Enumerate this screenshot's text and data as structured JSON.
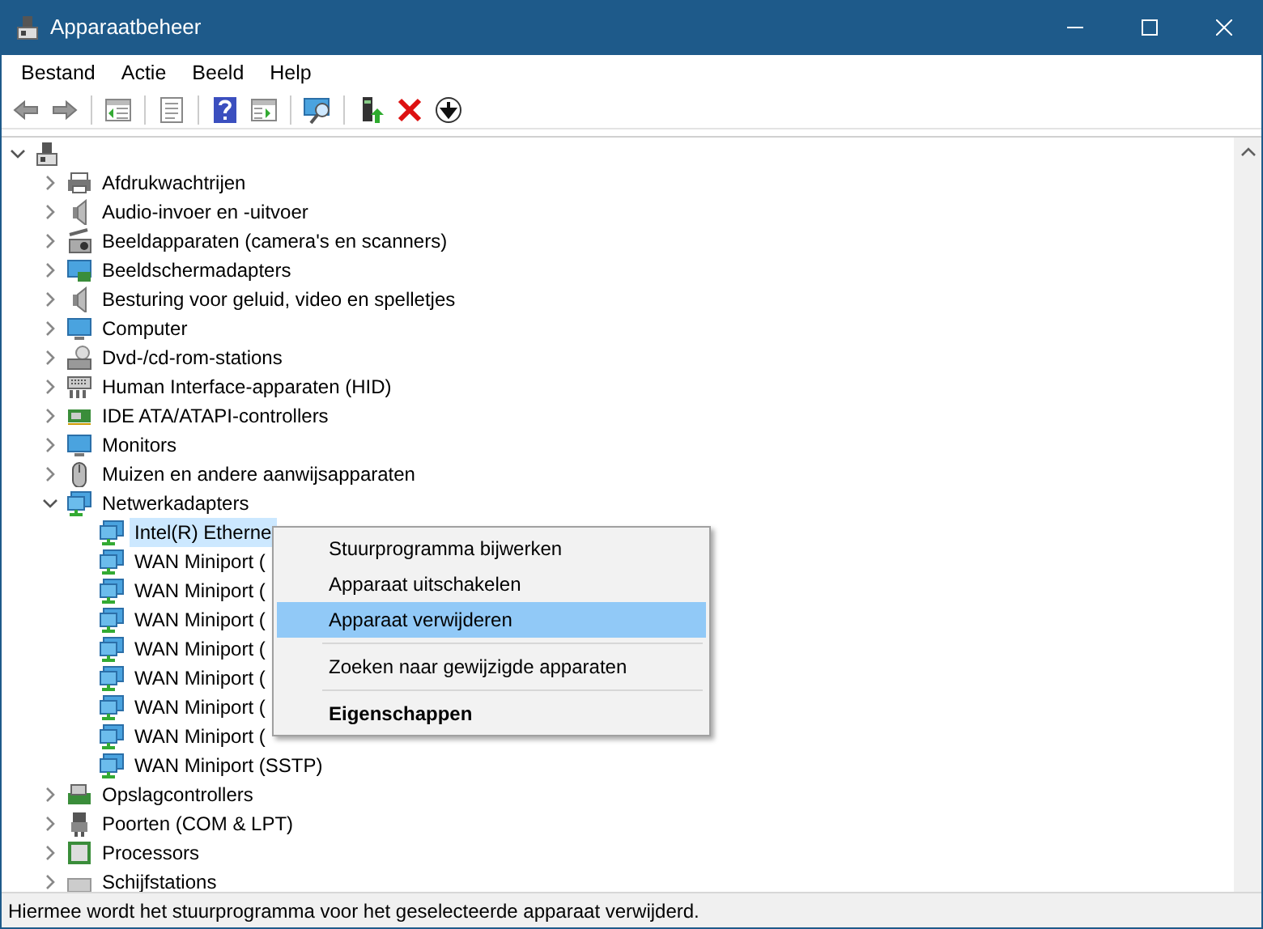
{
  "window": {
    "title": "Apparaatbeheer"
  },
  "menu_bar": [
    "Bestand",
    "Actie",
    "Beeld",
    "Help"
  ],
  "tree": {
    "expanded": true,
    "children": [
      {
        "label": "Afdrukwachtrijen",
        "expanded": false
      },
      {
        "label": "Audio-invoer en -uitvoer",
        "expanded": false
      },
      {
        "label": "Beeldapparaten (camera's en scanners)",
        "expanded": false
      },
      {
        "label": "Beeldschermadapters",
        "expanded": false
      },
      {
        "label": "Besturing voor geluid, video en spelletjes",
        "expanded": false
      },
      {
        "label": "Computer",
        "expanded": false
      },
      {
        "label": "Dvd-/cd-rom-stations",
        "expanded": false
      },
      {
        "label": "Human Interface-apparaten (HID)",
        "expanded": false
      },
      {
        "label": "IDE ATA/ATAPI-controllers",
        "expanded": false
      },
      {
        "label": "Monitors",
        "expanded": false
      },
      {
        "label": "Muizen en andere aanwijsapparaten",
        "expanded": false
      },
      {
        "label": "Netwerkadapters",
        "expanded": true,
        "children": [
          {
            "label": "Intel(R) Etherne",
            "selected": true
          },
          {
            "label": "WAN Miniport (",
            "selected": false
          },
          {
            "label": "WAN Miniport (",
            "selected": false
          },
          {
            "label": "WAN Miniport (",
            "selected": false
          },
          {
            "label": "WAN Miniport (",
            "selected": false
          },
          {
            "label": "WAN Miniport (",
            "selected": false
          },
          {
            "label": "WAN Miniport (",
            "selected": false
          },
          {
            "label": "WAN Miniport (",
            "selected": false
          },
          {
            "label": "WAN Miniport (SSTP)",
            "selected": false
          }
        ]
      },
      {
        "label": "Opslagcontrollers",
        "expanded": false
      },
      {
        "label": "Poorten (COM & LPT)",
        "expanded": false
      },
      {
        "label": "Processors",
        "expanded": false
      },
      {
        "label": "Schijfstations",
        "expanded": false
      }
    ]
  },
  "context_menu": [
    {
      "kind": "item",
      "label": "Stuurprogramma bijwerken",
      "selected": false,
      "default": false
    },
    {
      "kind": "item",
      "label": "Apparaat uitschakelen",
      "selected": false,
      "default": false
    },
    {
      "kind": "item",
      "label": "Apparaat verwijderen",
      "selected": true,
      "default": false
    },
    {
      "kind": "separator"
    },
    {
      "kind": "item",
      "label": "Zoeken naar gewijzigde apparaten",
      "selected": false,
      "default": false
    },
    {
      "kind": "separator"
    },
    {
      "kind": "item",
      "label": "Eigenschappen",
      "selected": false,
      "default": true
    }
  ],
  "status_bar": "Hiermee wordt het stuurprogramma voor het geselecteerde apparaat verwijderd."
}
